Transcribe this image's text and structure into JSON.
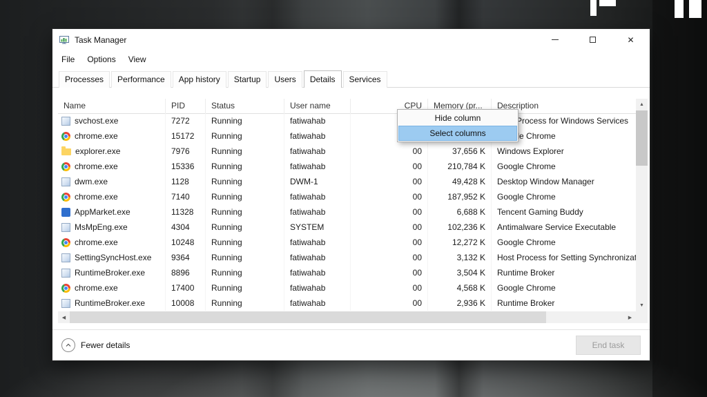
{
  "colors": {
    "menu_highlight_bg": "#9ccbf1",
    "menu_highlight_border": "#7ab2e3",
    "window_bg": "#ffffff",
    "disabled_button_text": "#9b9b9b"
  },
  "window": {
    "title": "Task Manager",
    "menu": [
      "File",
      "Options",
      "View"
    ],
    "tabs": [
      {
        "label": "Processes",
        "selected": false
      },
      {
        "label": "Performance",
        "selected": false
      },
      {
        "label": "App history",
        "selected": false
      },
      {
        "label": "Startup",
        "selected": false
      },
      {
        "label": "Users",
        "selected": false
      },
      {
        "label": "Details",
        "selected": true
      },
      {
        "label": "Services",
        "selected": false
      }
    ]
  },
  "table": {
    "columns": [
      "Name",
      "PID",
      "Status",
      "User name",
      "CPU",
      "Memory (pr...",
      "Description"
    ],
    "rows": [
      {
        "icon": "generic-exe-icon",
        "name": "svchost.exe",
        "pid": "7272",
        "status": "Running",
        "user": "fatiwahab",
        "cpu": "",
        "memory": "",
        "description": "Host Process for Windows Services"
      },
      {
        "icon": "chrome-icon",
        "name": "chrome.exe",
        "pid": "15172",
        "status": "Running",
        "user": "fatiwahab",
        "cpu": "",
        "memory": "",
        "description": "Google Chrome"
      },
      {
        "icon": "folder-icon",
        "name": "explorer.exe",
        "pid": "7976",
        "status": "Running",
        "user": "fatiwahab",
        "cpu": "00",
        "memory": "37,656 K",
        "description": "Windows Explorer"
      },
      {
        "icon": "chrome-icon",
        "name": "chrome.exe",
        "pid": "15336",
        "status": "Running",
        "user": "fatiwahab",
        "cpu": "00",
        "memory": "210,784 K",
        "description": "Google Chrome"
      },
      {
        "icon": "generic-exe-icon",
        "name": "dwm.exe",
        "pid": "1128",
        "status": "Running",
        "user": "DWM-1",
        "cpu": "00",
        "memory": "49,428 K",
        "description": "Desktop Window Manager"
      },
      {
        "icon": "chrome-icon",
        "name": "chrome.exe",
        "pid": "7140",
        "status": "Running",
        "user": "fatiwahab",
        "cpu": "00",
        "memory": "187,952 K",
        "description": "Google Chrome"
      },
      {
        "icon": "appmarket-icon",
        "name": "AppMarket.exe",
        "pid": "11328",
        "status": "Running",
        "user": "fatiwahab",
        "cpu": "00",
        "memory": "6,688 K",
        "description": "Tencent Gaming Buddy"
      },
      {
        "icon": "generic-exe-icon",
        "name": "MsMpEng.exe",
        "pid": "4304",
        "status": "Running",
        "user": "SYSTEM",
        "cpu": "00",
        "memory": "102,236 K",
        "description": "Antimalware Service Executable"
      },
      {
        "icon": "chrome-icon",
        "name": "chrome.exe",
        "pid": "10248",
        "status": "Running",
        "user": "fatiwahab",
        "cpu": "00",
        "memory": "12,272 K",
        "description": "Google Chrome"
      },
      {
        "icon": "generic-exe-icon",
        "name": "SettingSyncHost.exe",
        "pid": "9364",
        "status": "Running",
        "user": "fatiwahab",
        "cpu": "00",
        "memory": "3,132 K",
        "description": "Host Process for Setting Synchronization"
      },
      {
        "icon": "generic-exe-icon",
        "name": "RuntimeBroker.exe",
        "pid": "8896",
        "status": "Running",
        "user": "fatiwahab",
        "cpu": "00",
        "memory": "3,504 K",
        "description": "Runtime Broker"
      },
      {
        "icon": "chrome-icon",
        "name": "chrome.exe",
        "pid": "17400",
        "status": "Running",
        "user": "fatiwahab",
        "cpu": "00",
        "memory": "4,568 K",
        "description": "Google Chrome"
      },
      {
        "icon": "generic-exe-icon",
        "name": "RuntimeBroker.exe",
        "pid": "10008",
        "status": "Running",
        "user": "fatiwahab",
        "cpu": "00",
        "memory": "2,936 K",
        "description": "Runtime Broker"
      }
    ]
  },
  "context_menu": {
    "items": [
      {
        "label": "Hide column",
        "highlighted": false
      },
      {
        "label": "Select columns",
        "highlighted": true
      }
    ]
  },
  "footer": {
    "fewer_details_label": "Fewer details",
    "end_task_label": "End task"
  }
}
